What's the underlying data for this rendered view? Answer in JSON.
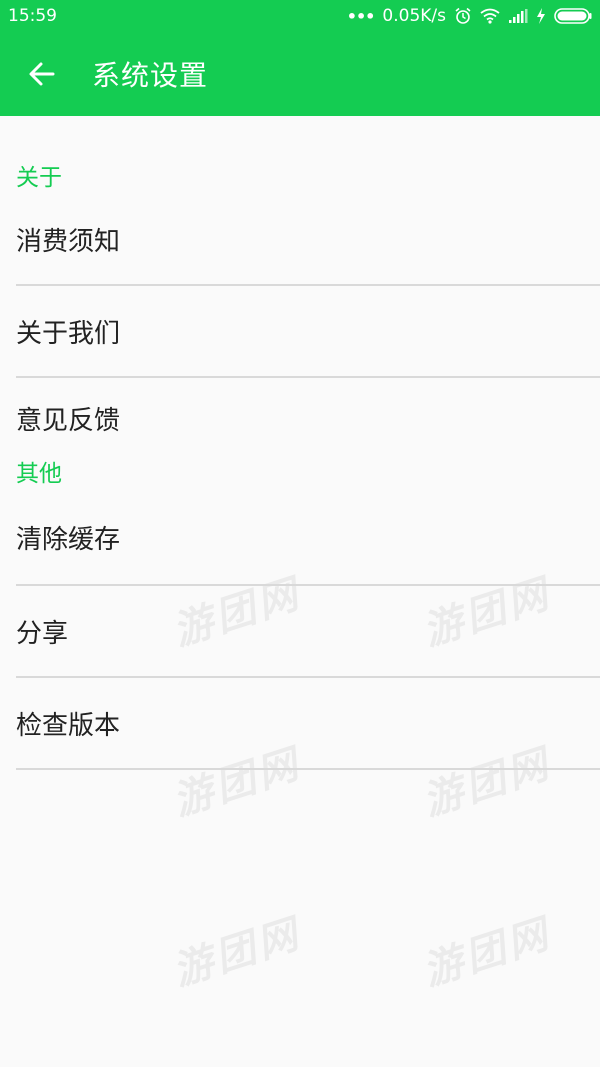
{
  "status_bar": {
    "time": "15:59",
    "dots": "•••",
    "net_speed": "0.05K/s",
    "icons": [
      "alarm-icon",
      "wifi-icon",
      "signal-icon",
      "charging-icon",
      "battery-icon"
    ]
  },
  "app_bar": {
    "title": "系统设置",
    "back_icon": "arrow-back-icon",
    "color": "#14cc52"
  },
  "sections": [
    {
      "header": "关于",
      "items": [
        "消费须知",
        "关于我们",
        "意见反馈"
      ]
    },
    {
      "header": "其他",
      "items": [
        "清除缓存",
        "分享",
        "检查版本"
      ]
    }
  ],
  "watermark": "游团网",
  "colors": {
    "accent": "#14cc52",
    "text": "#222222",
    "divider": "#d9d9d9",
    "background": "#fafafa"
  }
}
